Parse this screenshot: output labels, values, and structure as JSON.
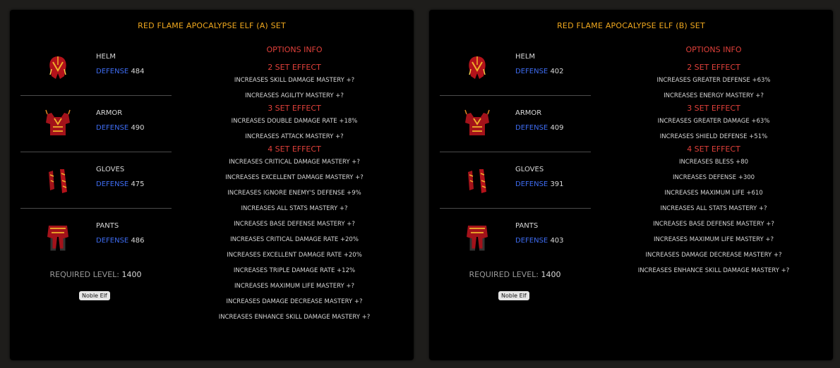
{
  "sets": [
    {
      "title": "RED FLAME APOCALYPSE ELF (A) SET",
      "items": [
        {
          "name": "HELM",
          "defense_label": "DEFENSE",
          "defense": "484",
          "icon": "helm-icon"
        },
        {
          "name": "ARMOR",
          "defense_label": "DEFENSE",
          "defense": "490",
          "icon": "armor-icon"
        },
        {
          "name": "GLOVES",
          "defense_label": "DEFENSE",
          "defense": "475",
          "icon": "gloves-icon"
        },
        {
          "name": "PANTS",
          "defense_label": "DEFENSE",
          "defense": "486",
          "icon": "pants-icon"
        }
      ],
      "required_label": "REQUIRED LEVEL:",
      "required_value": "1400",
      "class_badge": "Noble Elf",
      "options_title": "OPTIONS INFO",
      "effects": [
        {
          "title": "2 SET EFFECT",
          "lines": [
            "INCREASES SKILL DAMAGE MASTERY +?",
            "INCREASES AGILITY MASTERY +?"
          ]
        },
        {
          "title": "3 SET EFFECT",
          "lines": [
            "INCREASES DOUBLE DAMAGE RATE +18%",
            "INCREASES ATTACK MASTERY +?"
          ]
        },
        {
          "title": "4 SET EFFECT",
          "lines": [
            "INCREASES CRITICAL DAMAGE MASTERY +?",
            "INCREASES EXCELLENT DAMAGE MASTERY +?",
            "INCREASES IGNORE ENEMY'S DEFENSE +9%",
            "INCREASES ALL STATS MASTERY +?",
            "INCREASES BASE DEFENSE MASTERY +?",
            "INCREASES CRITICAL DAMAGE RATE +20%",
            "INCREASES EXCELLENT DAMAGE RATE +20%",
            "INCREASES TRIPLE DAMAGE RATE +12%",
            "INCREASES MAXIMUM LIFE MASTERY +?",
            "INCREASES DAMAGE DECREASE MASTERY +?",
            "INCREASES ENHANCE SKILL DAMAGE MASTERY +?"
          ]
        }
      ]
    },
    {
      "title": "RED FLAME APOCALYPSE ELF (B) SET",
      "items": [
        {
          "name": "HELM",
          "defense_label": "DEFENSE",
          "defense": "402",
          "icon": "helm-icon"
        },
        {
          "name": "ARMOR",
          "defense_label": "DEFENSE",
          "defense": "409",
          "icon": "armor-icon"
        },
        {
          "name": "GLOVES",
          "defense_label": "DEFENSE",
          "defense": "391",
          "icon": "gloves-icon"
        },
        {
          "name": "PANTS",
          "defense_label": "DEFENSE",
          "defense": "403",
          "icon": "pants-icon"
        }
      ],
      "required_label": "REQUIRED LEVEL:",
      "required_value": "1400",
      "class_badge": "Noble Elf",
      "options_title": "OPTIONS INFO",
      "effects": [
        {
          "title": "2 SET EFFECT",
          "lines": [
            "INCREASES GREATER DEFENSE +63%",
            "INCREASES ENERGY MASTERY +?"
          ]
        },
        {
          "title": "3 SET EFFECT",
          "lines": [
            "INCREASES GREATER DAMAGE +63%",
            "INCREASES SHIELD DEFENSE +51%"
          ]
        },
        {
          "title": "4 SET EFFECT",
          "lines": [
            "INCREASES BLESS +80",
            "INCREASES DEFENSE +300",
            "INCREASES MAXIMUM LIFE +610",
            "INCREASES ALL STATS MASTERY +?",
            "INCREASES BASE DEFENSE MASTERY +?",
            "INCREASES MAXIMUM LIFE MASTERY +?",
            "INCREASES DAMAGE DECREASE MASTERY +?",
            "INCREASES ENHANCE SKILL DAMAGE MASTERY +?"
          ]
        }
      ]
    }
  ],
  "colors": {
    "title": "#f0a81e",
    "effect_title": "#e0403a",
    "defense_label": "#3e6cf2",
    "panel_bg": "#000000",
    "page_bg": "#1e1d1b"
  }
}
